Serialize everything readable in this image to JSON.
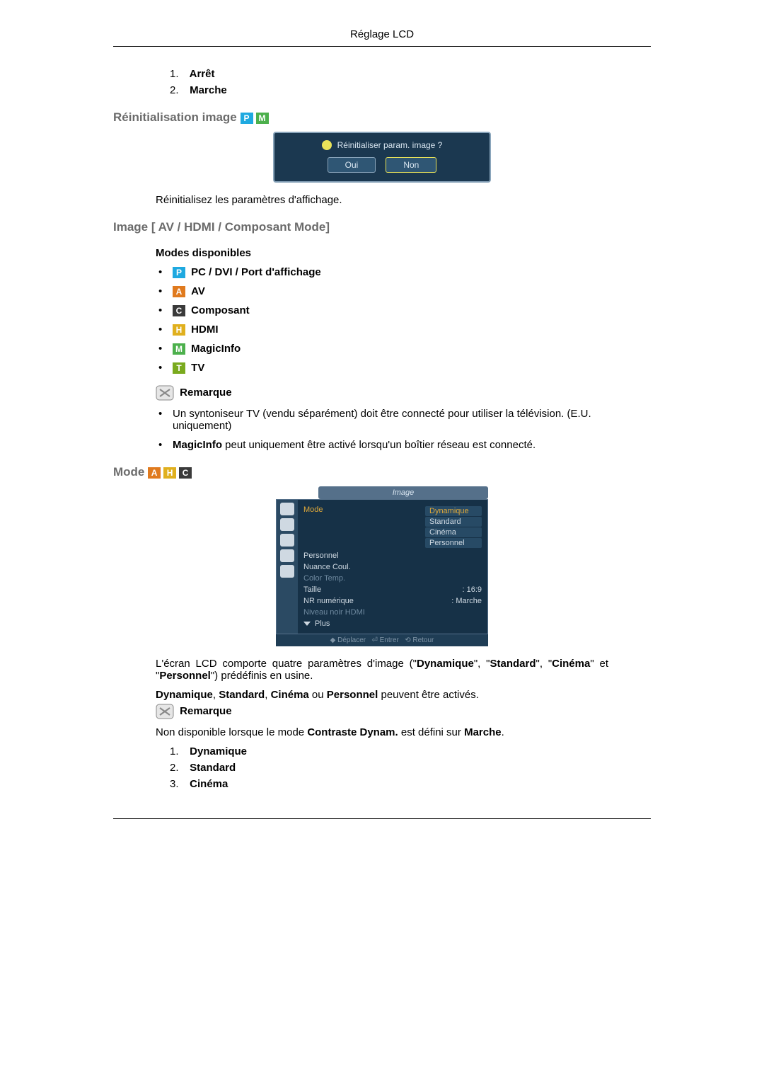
{
  "header": {
    "title": "Réglage LCD"
  },
  "topList": {
    "items": [
      {
        "num": "1.",
        "label": "Arrêt"
      },
      {
        "num": "2.",
        "label": "Marche"
      }
    ]
  },
  "reinitImage": {
    "heading": "Réinitialisation image",
    "dialog": {
      "question": "Réinitialiser param. image ?",
      "yes": "Oui",
      "no": "Non"
    },
    "desc": "Réinitialisez les paramètres d'affichage."
  },
  "imageAvSection": {
    "heading": "Image [ AV / HDMI / Composant Mode]",
    "modesLabel": "Modes disponibles",
    "modes": {
      "p": "PC / DVI / Port d'affichage",
      "a": "AV",
      "c": "Composant",
      "h": "HDMI",
      "m": "MagicInfo",
      "t": "TV"
    },
    "remarkLabel": "Remarque",
    "notes": {
      "tv": "Un syntoniseur TV (vendu séparément) doit être connecté pour utiliser la télévision. (E.U. uniquement)",
      "magicPrefix": "MagicInfo",
      "magicRest": " peut uniquement être activé lorsqu'un boîtier réseau est connecté."
    }
  },
  "modeSection": {
    "heading": "Mode ",
    "dialog": {
      "title": "Image",
      "rows": {
        "mode": "Mode",
        "personnel": "Personnel",
        "nuance": "Nuance Coul.",
        "colorTemp": "Color Temp.",
        "taille": "Taille",
        "nr": "NR numérique",
        "niveau": "Niveau noir HDMI",
        "plus": "Plus"
      },
      "vals": {
        "taille": ": 16:9",
        "nr": ": Marche"
      },
      "options": {
        "dyn": "Dynamique",
        "std": "Standard",
        "cin": "Cinéma",
        "per": "Personnel"
      },
      "footer": {
        "move": "Déplacer",
        "enter": "Entrer",
        "return": "Retour"
      }
    },
    "para1_a": "L'écran LCD comporte quatre paramètres d'image (\"",
    "para1_b": "Dynamique",
    "para1_c": "\", \"",
    "para1_d": "Standard",
    "para1_e": "\", \"",
    "para1_f": "Cinéma",
    "para1_g": "\" et \"",
    "para1_h": "Personnel",
    "para1_i": "\") prédéfinis en usine.",
    "para2_a": "Dynamique",
    "para2_b": ", ",
    "para2_c": "Standard",
    "para2_d": ", ",
    "para2_e": "Cinéma",
    "para2_f": " ou ",
    "para2_g": "Personnel",
    "para2_h": " peuvent être activés.",
    "remarkLabel": "Remarque",
    "para3_a": "Non disponible lorsque le mode ",
    "para3_b": "Contraste Dynam.",
    "para3_c": " est défini sur ",
    "para3_d": "Marche",
    "para3_e": ".",
    "list": {
      "i1n": "1.",
      "i1l": "Dynamique",
      "i2n": "2.",
      "i2l": "Standard",
      "i3n": "3.",
      "i3l": "Cinéma"
    }
  }
}
